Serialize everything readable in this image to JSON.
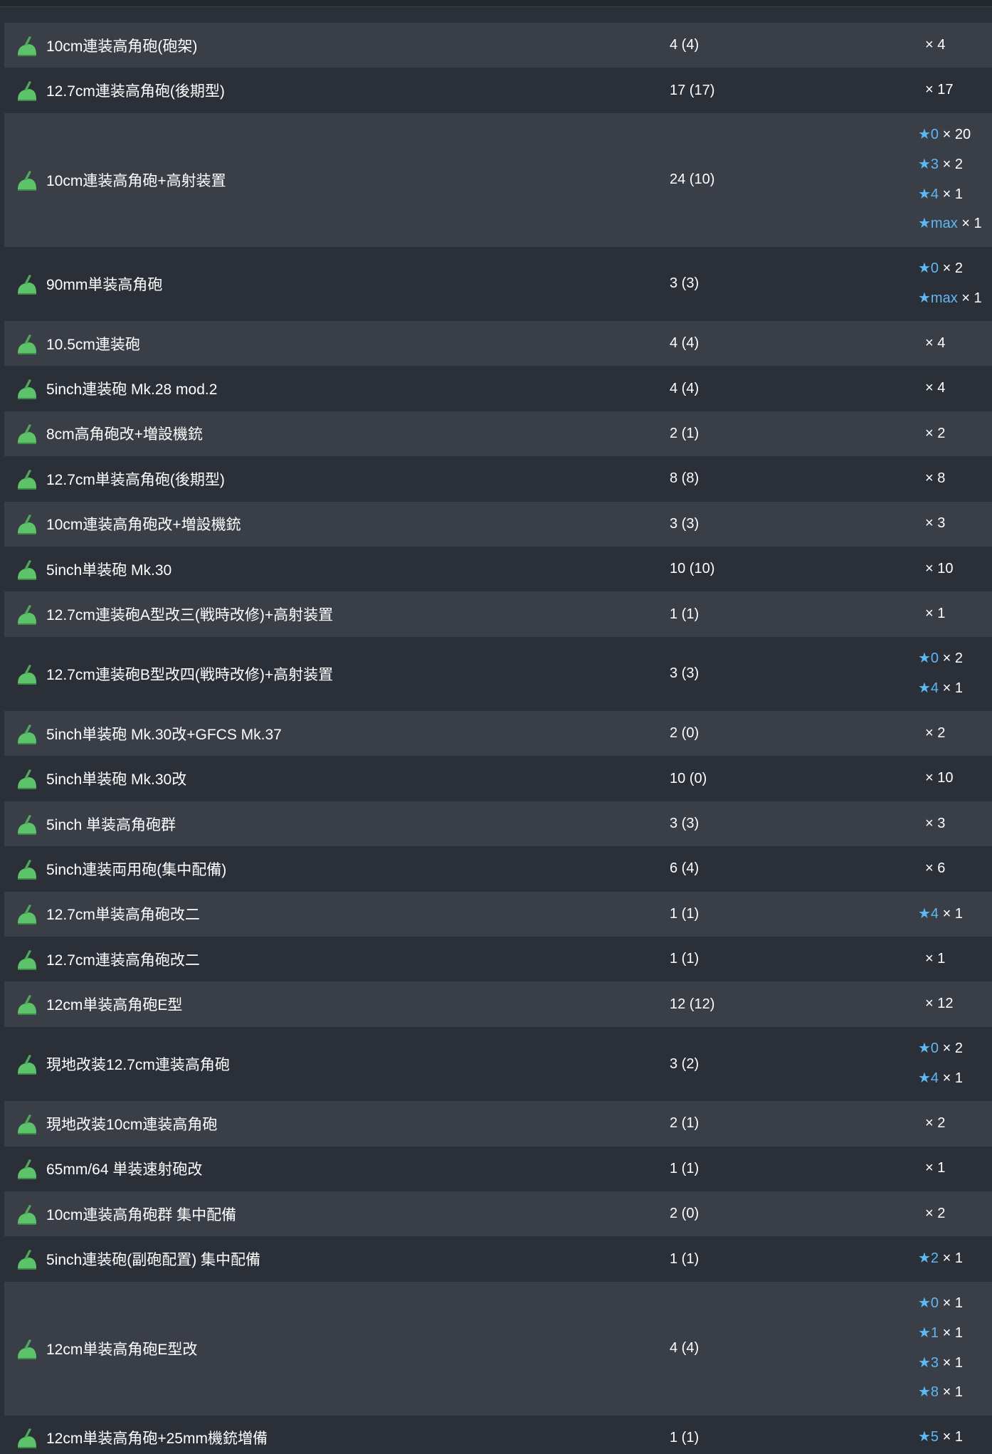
{
  "rows": [
    {
      "name": "10cm連装高角砲(砲架)",
      "count": "4 (4)",
      "stars": [
        {
          "star": "",
          "mult": "× 4"
        }
      ]
    },
    {
      "name": "12.7cm連装高角砲(後期型)",
      "count": "17 (17)",
      "stars": [
        {
          "star": "",
          "mult": "× 17"
        }
      ]
    },
    {
      "name": "10cm連装高角砲+高射装置",
      "count": "24 (10)",
      "stars": [
        {
          "star": "★0",
          "mult": "× 20"
        },
        {
          "star": "★3",
          "mult": "× 2"
        },
        {
          "star": "★4",
          "mult": "× 1"
        },
        {
          "star": "★max",
          "mult": "× 1"
        }
      ]
    },
    {
      "name": "90mm単装高角砲",
      "count": "3 (3)",
      "stars": [
        {
          "star": "★0",
          "mult": "× 2"
        },
        {
          "star": "★max",
          "mult": "× 1"
        }
      ]
    },
    {
      "name": "10.5cm連装砲",
      "count": "4 (4)",
      "stars": [
        {
          "star": "",
          "mult": "× 4"
        }
      ]
    },
    {
      "name": "5inch連装砲 Mk.28 mod.2",
      "count": "4 (4)",
      "stars": [
        {
          "star": "",
          "mult": "× 4"
        }
      ]
    },
    {
      "name": "8cm高角砲改+増設機銃",
      "count": "2 (1)",
      "stars": [
        {
          "star": "",
          "mult": "× 2"
        }
      ]
    },
    {
      "name": "12.7cm単装高角砲(後期型)",
      "count": "8 (8)",
      "stars": [
        {
          "star": "",
          "mult": "× 8"
        }
      ]
    },
    {
      "name": "10cm連装高角砲改+増設機銃",
      "count": "3 (3)",
      "stars": [
        {
          "star": "",
          "mult": "× 3"
        }
      ]
    },
    {
      "name": "5inch単装砲 Mk.30",
      "count": "10 (10)",
      "stars": [
        {
          "star": "",
          "mult": "× 10"
        }
      ]
    },
    {
      "name": "12.7cm連装砲A型改三(戦時改修)+高射装置",
      "count": "1 (1)",
      "stars": [
        {
          "star": "",
          "mult": "× 1"
        }
      ]
    },
    {
      "name": "12.7cm連装砲B型改四(戦時改修)+高射装置",
      "count": "3 (3)",
      "stars": [
        {
          "star": "★0",
          "mult": "× 2"
        },
        {
          "star": "★4",
          "mult": "× 1"
        }
      ]
    },
    {
      "name": "5inch単装砲 Mk.30改+GFCS Mk.37",
      "count": "2 (0)",
      "stars": [
        {
          "star": "",
          "mult": "× 2"
        }
      ]
    },
    {
      "name": "5inch単装砲 Mk.30改",
      "count": "10 (0)",
      "stars": [
        {
          "star": "",
          "mult": "× 10"
        }
      ]
    },
    {
      "name": "5inch 単装高角砲群",
      "count": "3 (3)",
      "stars": [
        {
          "star": "",
          "mult": "× 3"
        }
      ]
    },
    {
      "name": "5inch連装両用砲(集中配備)",
      "count": "6 (4)",
      "stars": [
        {
          "star": "",
          "mult": "× 6"
        }
      ]
    },
    {
      "name": "12.7cm単装高角砲改二",
      "count": "1 (1)",
      "stars": [
        {
          "star": "★4",
          "mult": "× 1"
        }
      ]
    },
    {
      "name": "12.7cm連装高角砲改二",
      "count": "1 (1)",
      "stars": [
        {
          "star": "",
          "mult": "× 1"
        }
      ]
    },
    {
      "name": "12cm単装高角砲E型",
      "count": "12 (12)",
      "stars": [
        {
          "star": "",
          "mult": "× 12"
        }
      ]
    },
    {
      "name": "現地改装12.7cm連装高角砲",
      "count": "3 (2)",
      "stars": [
        {
          "star": "★0",
          "mult": "× 2"
        },
        {
          "star": "★4",
          "mult": "× 1"
        }
      ]
    },
    {
      "name": "現地改装10cm連装高角砲",
      "count": "2 (1)",
      "stars": [
        {
          "star": "",
          "mult": "× 2"
        }
      ]
    },
    {
      "name": "65mm/64 単装速射砲改",
      "count": "1 (1)",
      "stars": [
        {
          "star": "",
          "mult": "× 1"
        }
      ]
    },
    {
      "name": "10cm連装高角砲群 集中配備",
      "count": "2 (0)",
      "stars": [
        {
          "star": "",
          "mult": "× 2"
        }
      ]
    },
    {
      "name": "5inch連装砲(副砲配置) 集中配備",
      "count": "1 (1)",
      "stars": [
        {
          "star": "★2",
          "mult": "× 1"
        }
      ]
    },
    {
      "name": "12cm単装高角砲E型改",
      "count": "4 (4)",
      "stars": [
        {
          "star": "★0",
          "mult": "× 1"
        },
        {
          "star": "★1",
          "mult": "× 1"
        },
        {
          "star": "★3",
          "mult": "× 1"
        },
        {
          "star": "★8",
          "mult": "× 1"
        }
      ]
    },
    {
      "name": "12cm単装高角砲+25mm機銃増備",
      "count": "1 (1)",
      "stars": [
        {
          "star": "★5",
          "mult": "× 1"
        }
      ]
    }
  ],
  "colors": {
    "background": "#2b2f37",
    "row_alt": "#3a3e47",
    "star": "#5eb8f4",
    "icon_green": "#5cc36a"
  },
  "icon": "green-high-angle-gun-icon"
}
